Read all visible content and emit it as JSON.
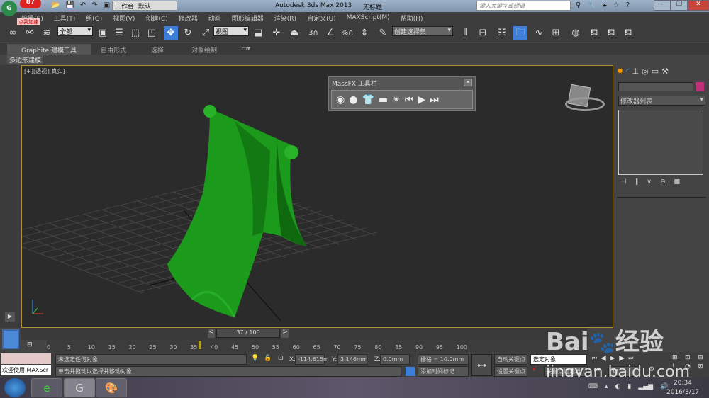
{
  "title": {
    "badge": "87",
    "badge_caption": "点我加速",
    "workspace": "工作台: 默认",
    "app": "Autodesk 3ds Max  2013",
    "doc": "无标题",
    "search_placeholder": "键入关键字或短语"
  },
  "menu": [
    "编辑(E)",
    "工具(T)",
    "组(G)",
    "视图(V)",
    "创建(C)",
    "修改器",
    "动画",
    "图形编辑器",
    "渲染(R)",
    "自定义(U)",
    "MAXScript(M)",
    "帮助(H)"
  ],
  "toolbar": {
    "filter": "全部",
    "coord": "视图",
    "snap_3": "3",
    "snap_pct": "%",
    "selset": "创建选择集"
  },
  "ribbon": {
    "tabs": [
      "Graphite 建模工具",
      "自由形式",
      "选择",
      "对象绘制"
    ],
    "sub": "多边形建模"
  },
  "viewport": {
    "label": "[+][透视][真实]"
  },
  "massfx": {
    "title": "MassFX 工具栏"
  },
  "cmdpanel": {
    "modlist": "修改器列表",
    "color": "#c0307a"
  },
  "timeline": {
    "frame": "37 / 100",
    "ticks": [
      "0",
      "5",
      "10",
      "15",
      "20",
      "25",
      "30",
      "35",
      "40",
      "45",
      "50",
      "55",
      "60",
      "65",
      "70",
      "75",
      "80",
      "85",
      "90",
      "95",
      "100"
    ],
    "current": 37
  },
  "status": {
    "maxscript": "欢迎使用 MAXScr",
    "selection": "未选定任何对象",
    "prompt": "单击并拖动以选择并移动对象",
    "x": "-114.615m",
    "y": "3.146mm",
    "z": "0.0mm",
    "grid": "栅格 = 10.0mm",
    "add_tag": "添加时间标记",
    "autokey": "自动关键点",
    "setkey": "设置关键点",
    "selected": "选定对象",
    "keyfilter": "关键点过滤器...",
    "frame_field": "37"
  },
  "taskbar": {
    "time": "20:34",
    "date": "2016/3/17"
  },
  "watermark": {
    "brand": "Bai du 经验",
    "url": "jingyan.baidu.com"
  }
}
